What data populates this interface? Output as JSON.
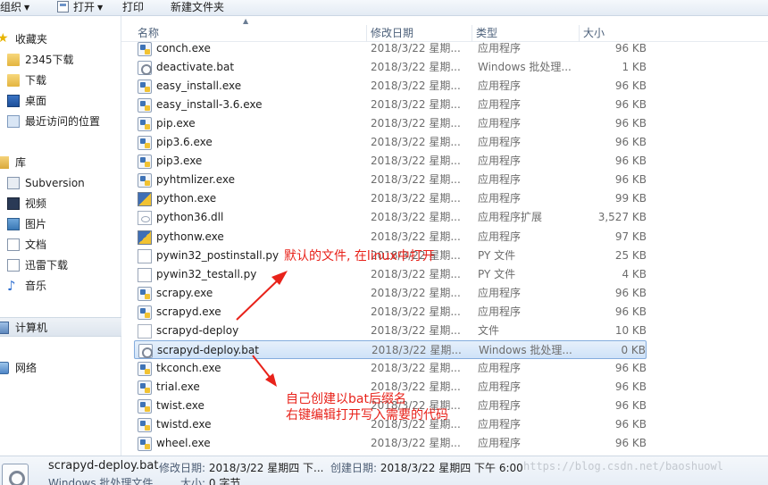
{
  "toolbar": {
    "organize": "组织",
    "open": "打开",
    "print": "打印",
    "new_folder": "新建文件夹"
  },
  "nav": {
    "favorites": "收藏夹",
    "downloads_2345": "2345下载",
    "downloads": "下载",
    "desktop": "桌面",
    "recent": "最近访问的位置",
    "libraries": "库",
    "subversion": "Subversion",
    "videos": "视频",
    "pictures": "图片",
    "documents": "文档",
    "thunder": "迅雷下载",
    "music": "音乐",
    "computer": "计算机",
    "network": "网络"
  },
  "columns": {
    "name": "名称",
    "date": "修改日期",
    "type": "类型",
    "size": "大小"
  },
  "files": [
    {
      "name": "conch.exe",
      "date": "2018/3/22 星期...",
      "type": "应用程序",
      "size": "96 KB",
      "icon": "exe-icon"
    },
    {
      "name": "deactivate.bat",
      "date": "2018/3/22 星期...",
      "type": "Windows 批处理...",
      "size": "1 KB",
      "icon": "bat-icon"
    },
    {
      "name": "easy_install.exe",
      "date": "2018/3/22 星期...",
      "type": "应用程序",
      "size": "96 KB",
      "icon": "exe-icon"
    },
    {
      "name": "easy_install-3.6.exe",
      "date": "2018/3/22 星期...",
      "type": "应用程序",
      "size": "96 KB",
      "icon": "exe-icon"
    },
    {
      "name": "pip.exe",
      "date": "2018/3/22 星期...",
      "type": "应用程序",
      "size": "96 KB",
      "icon": "exe-icon"
    },
    {
      "name": "pip3.6.exe",
      "date": "2018/3/22 星期...",
      "type": "应用程序",
      "size": "96 KB",
      "icon": "exe-icon"
    },
    {
      "name": "pip3.exe",
      "date": "2018/3/22 星期...",
      "type": "应用程序",
      "size": "96 KB",
      "icon": "exe-icon"
    },
    {
      "name": "pyhtmlizer.exe",
      "date": "2018/3/22 星期...",
      "type": "应用程序",
      "size": "96 KB",
      "icon": "exe-icon"
    },
    {
      "name": "python.exe",
      "date": "2018/3/22 星期...",
      "type": "应用程序",
      "size": "99 KB",
      "icon": "python-icon"
    },
    {
      "name": "python36.dll",
      "date": "2018/3/22 星期...",
      "type": "应用程序扩展",
      "size": "3,527 KB",
      "icon": "dll-icon"
    },
    {
      "name": "pythonw.exe",
      "date": "2018/3/22 星期...",
      "type": "应用程序",
      "size": "97 KB",
      "icon": "python-icon"
    },
    {
      "name": "pywin32_postinstall.py",
      "date": "2018/3/22 星期...",
      "type": "PY 文件",
      "size": "25 KB",
      "icon": "py-file-icon"
    },
    {
      "name": "pywin32_testall.py",
      "date": "2018/3/22 星期...",
      "type": "PY 文件",
      "size": "4 KB",
      "icon": "py-file-icon"
    },
    {
      "name": "scrapy.exe",
      "date": "2018/3/22 星期...",
      "type": "应用程序",
      "size": "96 KB",
      "icon": "exe-icon"
    },
    {
      "name": "scrapyd.exe",
      "date": "2018/3/22 星期...",
      "type": "应用程序",
      "size": "96 KB",
      "icon": "exe-icon"
    },
    {
      "name": "scrapyd-deploy",
      "date": "2018/3/22 星期...",
      "type": "文件",
      "size": "10 KB",
      "icon": "blank-file-icon"
    },
    {
      "name": "scrapyd-deploy.bat",
      "date": "2018/3/22 星期...",
      "type": "Windows 批处理...",
      "size": "0 KB",
      "icon": "bat-icon",
      "selected": true
    },
    {
      "name": "tkconch.exe",
      "date": "2018/3/22 星期...",
      "type": "应用程序",
      "size": "96 KB",
      "icon": "exe-icon"
    },
    {
      "name": "trial.exe",
      "date": "2018/3/22 星期...",
      "type": "应用程序",
      "size": "96 KB",
      "icon": "exe-icon"
    },
    {
      "name": "twist.exe",
      "date": "2018/3/22 星期...",
      "type": "应用程序",
      "size": "96 KB",
      "icon": "exe-icon"
    },
    {
      "name": "twistd.exe",
      "date": "2018/3/22 星期...",
      "type": "应用程序",
      "size": "96 KB",
      "icon": "exe-icon"
    },
    {
      "name": "wheel.exe",
      "date": "2018/3/22 星期...",
      "type": "应用程序",
      "size": "96 KB",
      "icon": "exe-icon"
    }
  ],
  "annotations": {
    "note1": "默认的文件, 在linux中打开",
    "note2_line1": "自己创建以bat后缀名",
    "note2_line2": "右键编辑打开写入需要的代码"
  },
  "details": {
    "name": "scrapyd-deploy.bat",
    "modified_label": "修改日期:",
    "modified_value": "2018/3/22 星期四 下...",
    "created_label": "创建日期:",
    "created_value": "2018/3/22 星期四 下午 6:00",
    "type": "Windows 批处理文件",
    "size_label": "大小:",
    "size_value": "0 字节",
    "watermark": "https://blog.csdn.net/baoshuowl"
  },
  "colors": {
    "annotation": "#e8221a",
    "selection_border": "#84acdd"
  }
}
